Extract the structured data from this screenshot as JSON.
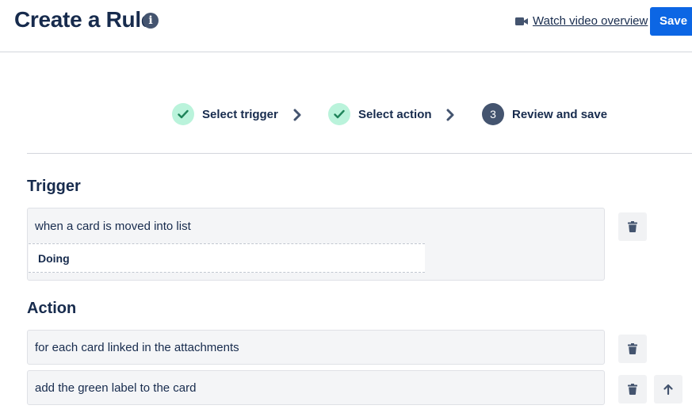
{
  "header": {
    "title": "Create a Rule",
    "info_icon": "info-icon",
    "video_link": "Watch video overview",
    "video_icon": "video-camera-icon",
    "save_label": "Save"
  },
  "steps": [
    {
      "label": "Select trigger",
      "state": "done",
      "icon": "check-icon"
    },
    {
      "label": "Select action",
      "state": "done",
      "icon": "check-icon"
    },
    {
      "label": "Review and save",
      "state": "current",
      "number": "3"
    }
  ],
  "trigger": {
    "heading": "Trigger",
    "text": "when a card is moved into list",
    "list_value": "Doing"
  },
  "action": {
    "heading": "Action",
    "items": [
      {
        "text": "for each card linked in the attachments"
      },
      {
        "text": "add the green label to the card"
      }
    ]
  },
  "colors": {
    "primary": "#0c66e4",
    "text": "#172b4d",
    "step_done_bg": "#baf3db",
    "step_done_check": "#1f845a",
    "step_current_bg": "#44546f"
  }
}
